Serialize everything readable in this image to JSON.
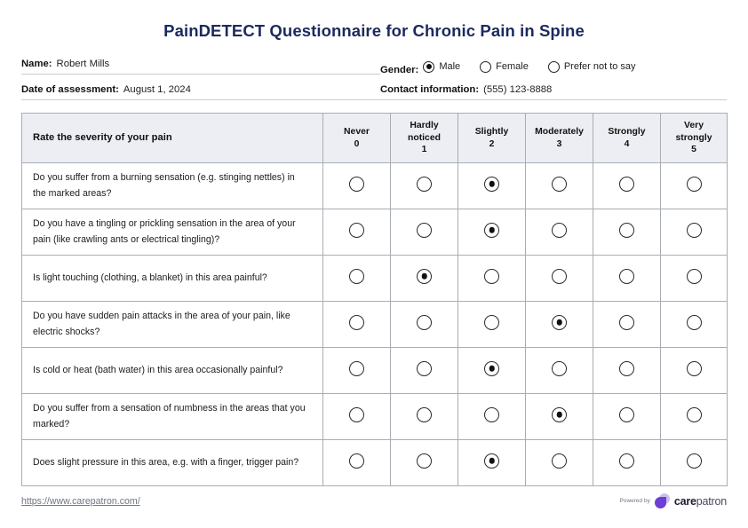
{
  "document": {
    "title": "PainDETECT Questionnaire for Chronic Pain in Spine",
    "title_color": "#1b2a5e"
  },
  "patient_info": {
    "name_label": "Name:",
    "name_value": "Robert Mills",
    "date_label": "Date of assessment:",
    "date_value": "August 1, 2024",
    "gender_label": "Gender:",
    "gender_options": [
      "Male",
      "Female",
      "Prefer not to say"
    ],
    "gender_selected": 0,
    "contact_label": "Contact information:",
    "contact_value": "(555) 123-8888"
  },
  "table": {
    "question_header": "Rate the severity of your pain",
    "scale": [
      {
        "label": "Never",
        "score": "0"
      },
      {
        "label": "Hardly\nnoticed",
        "score": "1"
      },
      {
        "label": "Slightly",
        "score": "2"
      },
      {
        "label": "Moderately",
        "score": "3"
      },
      {
        "label": "Strongly",
        "score": "4"
      },
      {
        "label": "Very\nstrongly",
        "score": "5"
      }
    ],
    "scale_labels": [
      "Never",
      "Hardly noticed",
      "Slightly",
      "Moderately",
      "Strongly",
      "Very strongly"
    ],
    "rows": [
      {
        "question": "Do you suffer from a burning sensation (e.g. stinging nettles) in the marked areas?",
        "selected": 2
      },
      {
        "question": "Do you have a tingling or prickling sensation in the area of your pain (like crawling ants or electrical tingling)?",
        "selected": 2
      },
      {
        "question": "Is light touching (clothing, a blanket) in this area painful?",
        "selected": 1
      },
      {
        "question": "Do you have sudden pain attacks in the area of your pain, like electric shocks?",
        "selected": 3
      },
      {
        "question": "Is cold or heat (bath water) in this area occasionally painful?",
        "selected": 2
      },
      {
        "question": "Do you suffer from a sensation of numbness in the areas that you marked?",
        "selected": 3
      },
      {
        "question": "Does slight pressure in this area, e.g. with a finger, trigger pain?",
        "selected": 2
      }
    ]
  },
  "footer": {
    "url": "https://www.carepatron.com/",
    "powered_by": "Powered by",
    "brand_bold": "care",
    "brand_light": "patron",
    "brand_color_dark": "#6d3fd4",
    "brand_color_light": "#cdbdf5"
  }
}
